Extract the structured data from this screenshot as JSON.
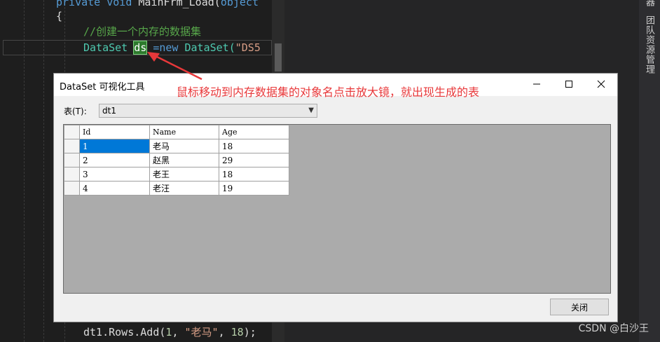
{
  "editor": {
    "line0": {
      "kw1": "private",
      "kw2": "void",
      "name": "MainFrm_Load(",
      "param": "object"
    },
    "line1": "{",
    "line2": "//创建一个内存的数据集",
    "line3": {
      "type": "DataSet",
      "var": "ds",
      "op": "=new",
      "ctor": "DataSet(",
      "str": "\"DS5"
    },
    "line_bottom": {
      "obj": "dt1.Rows.Add(",
      "num1": "1",
      "sep1": ", ",
      "str": "\"老马\"",
      "sep2": ", ",
      "num2": "18",
      "end": ");"
    }
  },
  "side": {
    "team_explorer": "团队资源管理",
    "top_partial": "器"
  },
  "watermark": "CSDN @白沙王",
  "annotation": "鼠标移动到内存数据集的对象名点击放大镜，就出现生成的表",
  "dialog": {
    "title": "DataSet 可视化工具",
    "table_label": "表(T):",
    "table_value": "dt1",
    "close_label": "关闭",
    "columns": [
      "Id",
      "Name",
      "Age"
    ],
    "rows": [
      {
        "id": "1",
        "name": "老马",
        "age": "18"
      },
      {
        "id": "2",
        "name": "赵黑",
        "age": "29"
      },
      {
        "id": "3",
        "name": "老王",
        "age": "18"
      },
      {
        "id": "4",
        "name": "老汪",
        "age": "19"
      }
    ]
  },
  "colors": {
    "annotation": "#e8383a",
    "selection": "#0078d7",
    "highlight": "#2d7a2d"
  },
  "icons": {
    "minimize": "minimize-icon",
    "maximize": "maximize-icon",
    "close": "close-icon",
    "dropdown": "chevron-down-icon"
  }
}
